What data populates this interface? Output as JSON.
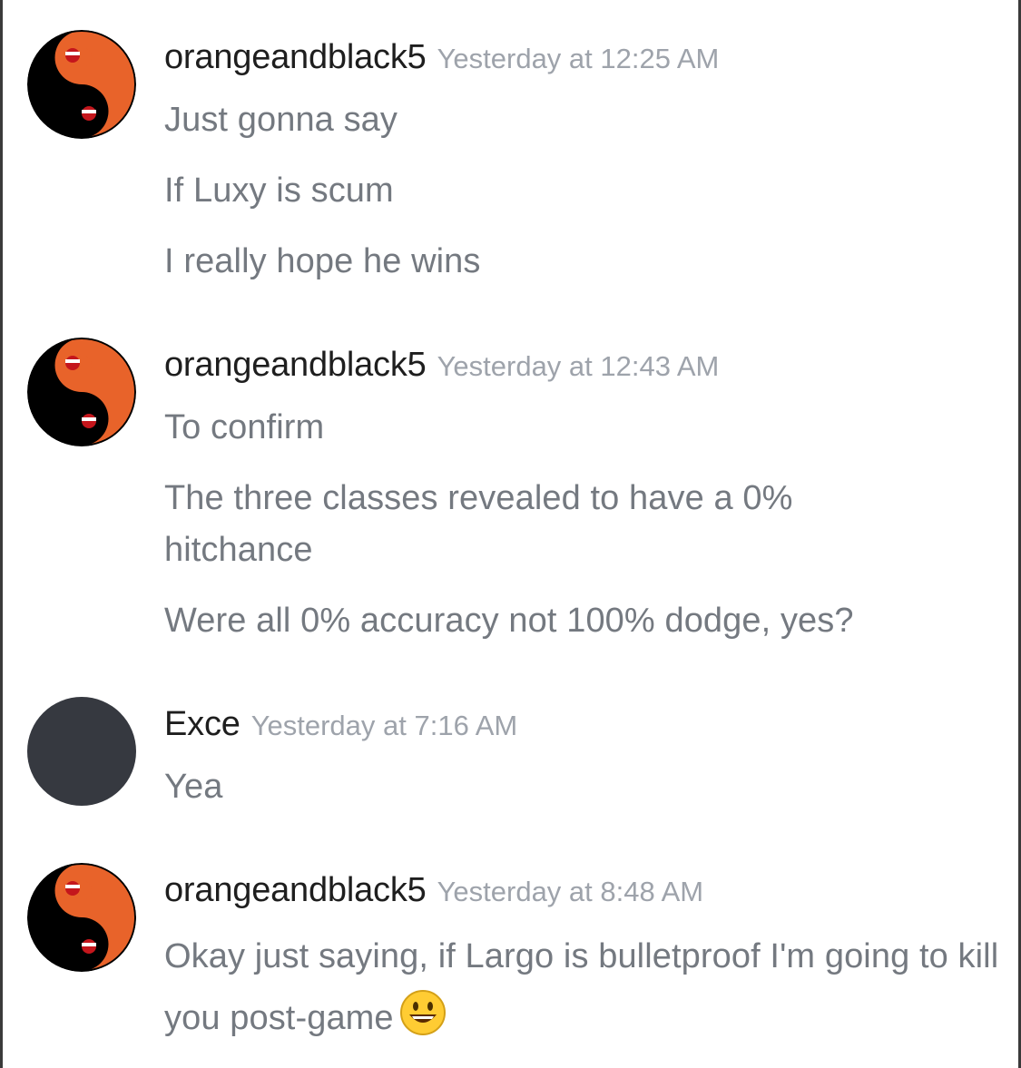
{
  "colors": {
    "username": "#1e1e1e",
    "timestamp": "#9ea3ab",
    "message_text": "#747980",
    "avatar_orange": "#e8632a",
    "avatar_black": "#000000",
    "default_avatar": "#363940"
  },
  "messages": [
    {
      "author": "orangeandblack5",
      "avatar": "yin-yang-avatar",
      "timestamp": "Yesterday at 12:25 AM",
      "lines": [
        "Just gonna say",
        "If Luxy is scum",
        "I really hope he wins"
      ]
    },
    {
      "author": "orangeandblack5",
      "avatar": "yin-yang-avatar",
      "timestamp": "Yesterday at 12:43 AM",
      "lines": [
        "To confirm",
        "The three classes revealed to have a 0% hitchance",
        "Were all 0% accuracy not 100% dodge, yes?"
      ]
    },
    {
      "author": "Exce",
      "avatar": "default-dark-avatar",
      "timestamp": "Yesterday at 7:16 AM",
      "lines": [
        "Yea"
      ]
    },
    {
      "author": "orangeandblack5",
      "avatar": "yin-yang-avatar",
      "timestamp": "Yesterday at 8:48 AM",
      "lines": [
        "Okay just saying, if Largo is bulletproof I'm going to kill you post-game"
      ],
      "emoji": "smiley-emoji-icon"
    }
  ]
}
